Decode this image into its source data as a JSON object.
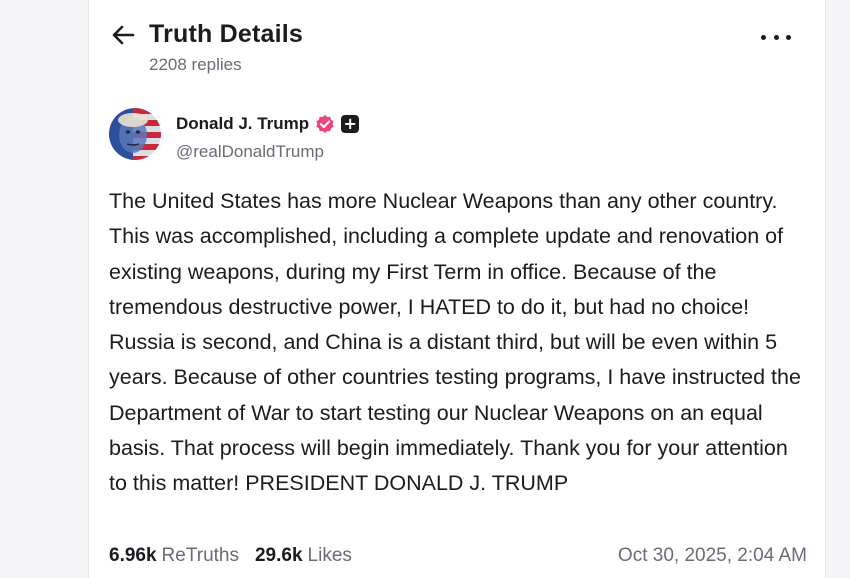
{
  "header": {
    "title": "Truth Details",
    "replies": "2208 replies"
  },
  "post": {
    "author_name": "Donald J. Trump",
    "author_handle": "@realDonaldTrump",
    "body": "The United States has more Nuclear Weapons than any other country. This was accomplished, including a complete update and renovation of existing weapons, during my First Term in office. Because of the tremendous destructive power, I HATED to do it, but had no choice! Russia is second, and China is a distant third, but will be even within 5 years. Because of other countries testing programs, I have instructed the Department of War to start testing our Nuclear Weapons on an equal basis. That process will begin immediately. Thank you for your attention to this matter! PRESIDENT DONALD J. TRUMP",
    "retruths_count": "6.96k",
    "retruths_label": "ReTruths",
    "likes_count": "29.6k",
    "likes_label": "Likes",
    "timestamp": "Oct 30, 2025, 2:04 AM"
  },
  "icons": {
    "back": "arrow-left-icon",
    "more": "more-horizontal-icon",
    "verified": "verified-badge-icon",
    "plus": "plus-badge-icon"
  },
  "colors": {
    "text_primary": "#1b1b20",
    "text_secondary": "#6b6b78",
    "verified_badge": "#e8467c"
  }
}
